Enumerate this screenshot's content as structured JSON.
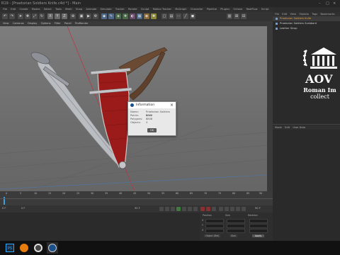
{
  "window": {
    "title": "R19 - [Praetorian Soldiers Knife.c4d *] - Main"
  },
  "menubar": {
    "items": [
      "File",
      "Edit",
      "Create",
      "Modes",
      "Select",
      "Tools",
      "Mesh",
      "Snap",
      "Animate",
      "Simulate",
      "Tracker",
      "Render",
      "Sculpt",
      "Motion Tracker",
      "MoGraph",
      "Character",
      "Pipeline",
      "Plugins",
      "Octane",
      "RealFlow",
      "Script",
      "Window",
      "Help"
    ]
  },
  "viewport": {
    "menu": [
      "View",
      "Cameras",
      "Display",
      "Options",
      "Filter",
      "Panel",
      "ProRender"
    ]
  },
  "dialog": {
    "title": "Information",
    "rows": [
      {
        "key": "Name:",
        "value": "Praetorian Soldiers Knife"
      },
      {
        "key": "Points:",
        "value": "8812"
      },
      {
        "key": "Polygons:",
        "value": "8808"
      },
      {
        "key": "Objects:",
        "value": "3"
      }
    ],
    "ok_label": "OK"
  },
  "objects_panel": {
    "menu": [
      "File",
      "Edit",
      "View",
      "Objects",
      "Tags",
      "Bookmarks"
    ],
    "items": [
      {
        "label": "Praetorian Soldiers Knife",
        "selected": true
      },
      {
        "label": "Praetorian Soldiers Scabbard",
        "selected": false
      },
      {
        "label": "Leather Strap",
        "selected": false
      }
    ]
  },
  "attributes_panel": {
    "menu": [
      "Mode",
      "Edit",
      "User Data"
    ]
  },
  "logo": {
    "line1": "Roman Im",
    "line2": "collect"
  },
  "timeline": {
    "ticks": [
      "0",
      "5",
      "10",
      "15",
      "20",
      "25",
      "30",
      "35",
      "40",
      "45",
      "50",
      "55",
      "60",
      "65",
      "70",
      "75",
      "80",
      "85",
      "90"
    ],
    "start": "0 F",
    "current": "0 F",
    "end": "90 F",
    "fps_end": "90 F"
  },
  "coords": {
    "labels": [
      "Position",
      "Size",
      "Rotation"
    ],
    "axes": [
      "X",
      "Y",
      "Z"
    ],
    "object_mode": "Object (Rel)",
    "size_mode": "Size",
    "apply_label": "Apply"
  },
  "taskbar": {
    "apps": [
      "PS",
      "Blender",
      "Maxon",
      "Cinema 4D"
    ]
  },
  "colors": {
    "accent": "#e8a040",
    "scabbard_red": "#9b1b1b",
    "viewport_bg": "#767676"
  }
}
